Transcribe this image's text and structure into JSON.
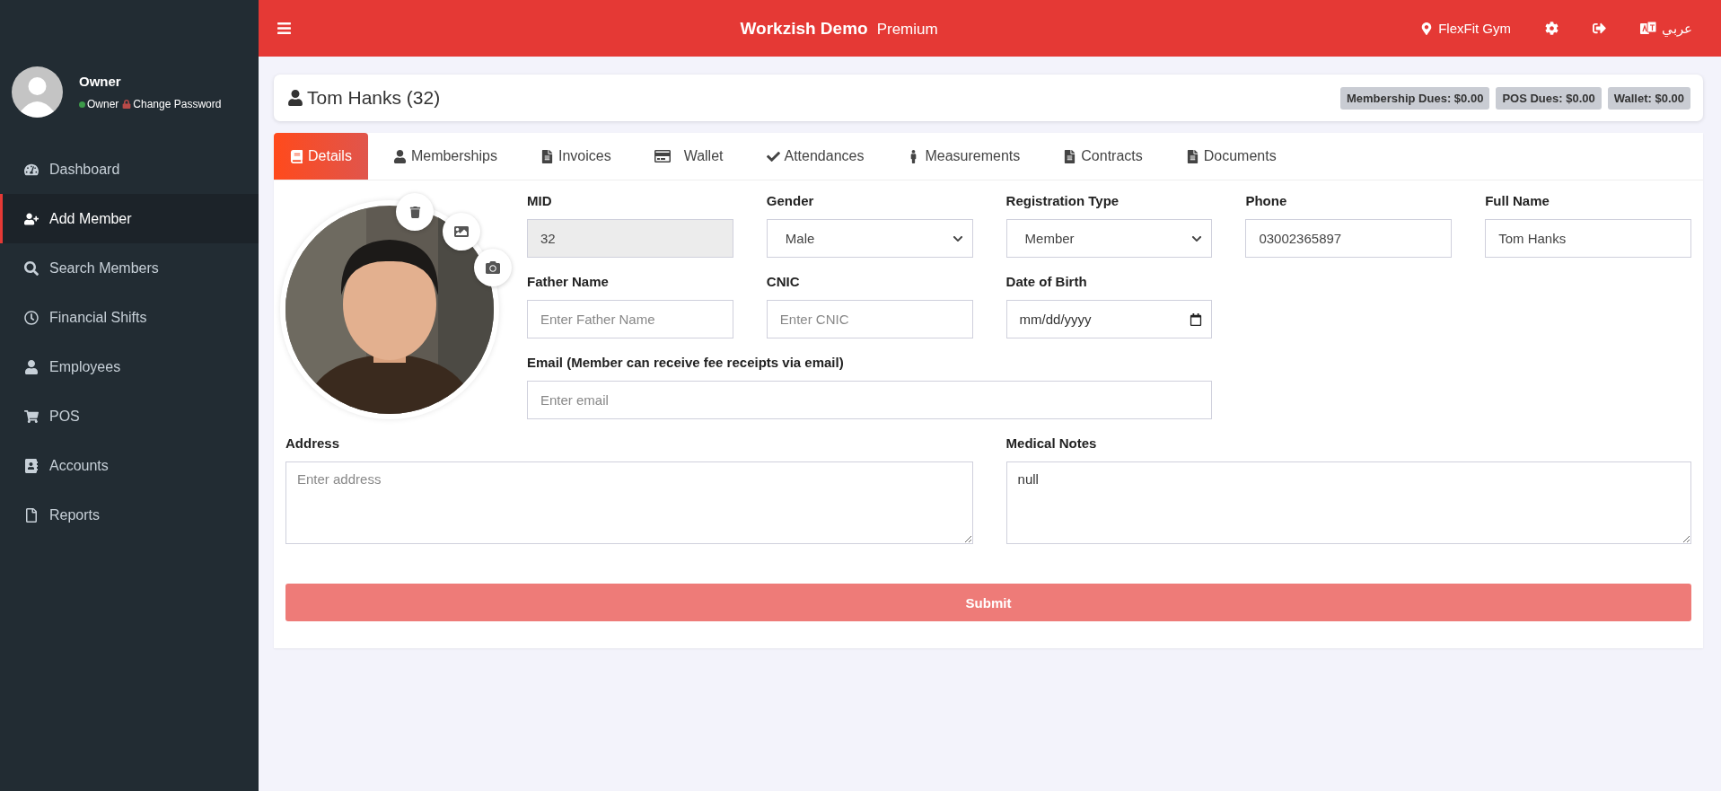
{
  "sidebar": {
    "user": {
      "name": "Owner",
      "role": "Owner",
      "online": true,
      "link": "Change Password"
    },
    "items": [
      {
        "label": "Dashboard",
        "selected": false
      },
      {
        "label": "Add Member",
        "selected": true
      },
      {
        "label": "Search Members",
        "selected": false
      },
      {
        "label": "Financial Shifts",
        "selected": false
      },
      {
        "label": "Employees",
        "selected": false
      },
      {
        "label": "POS",
        "selected": false
      },
      {
        "label": "Accounts",
        "selected": false
      },
      {
        "label": "Reports",
        "selected": false
      }
    ]
  },
  "header": {
    "title": "Workzish Demo",
    "plan": "Premium",
    "location": "FlexFit Gym",
    "language": "عربي"
  },
  "member": {
    "title": "Tom Hanks (32)",
    "badges": [
      "Membership Dues: $0.00",
      "POS Dues: $0.00",
      "Wallet: $0.00"
    ]
  },
  "tabs": [
    {
      "label": "Details",
      "selected": true
    },
    {
      "label": "Memberships",
      "selected": false
    },
    {
      "label": "Invoices",
      "selected": false
    },
    {
      "label": "Wallet",
      "selected": false
    },
    {
      "label": "Attendances",
      "selected": false
    },
    {
      "label": "Measurements",
      "selected": false
    },
    {
      "label": "Contracts",
      "selected": false
    },
    {
      "label": "Documents",
      "selected": false
    }
  ],
  "fields": [
    {
      "label": "MID",
      "kind": "text",
      "value": "32",
      "disabled": true
    },
    {
      "label": "Gender",
      "kind": "select",
      "value": "Male",
      "disabled": false
    },
    {
      "label": "Registration Type",
      "kind": "select",
      "value": "Member",
      "disabled": false
    },
    {
      "label": "Phone",
      "kind": "text",
      "value": "03002365897",
      "disabled": false
    },
    {
      "label": "Full Name",
      "kind": "text",
      "value": "Tom Hanks",
      "disabled": false
    },
    {
      "label": "Father Name",
      "kind": "text",
      "placeholder": "Enter Father Name",
      "disabled": false
    },
    {
      "label": "CNIC",
      "kind": "text",
      "placeholder": "Enter CNIC",
      "disabled": false
    },
    {
      "label": "Date of Birth",
      "kind": "date",
      "placeholder": "mm/dd/yyyy",
      "disabled": false
    },
    {
      "label": "Email (Member can receive fee receipts via email)",
      "kind": "email",
      "placeholder": "Enter email",
      "disabled": false
    },
    {
      "label": "Address",
      "kind": "textarea",
      "placeholder": "Enter address",
      "disabled": false
    },
    {
      "label": "Medical Notes",
      "kind": "textarea",
      "value": "null",
      "disabled": false
    }
  ],
  "submit": "Submit"
}
